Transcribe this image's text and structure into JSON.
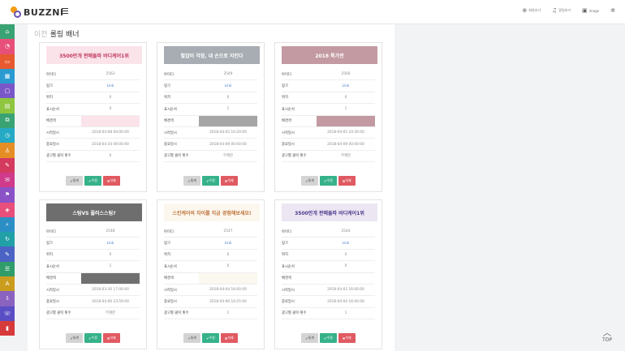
{
  "app": {
    "logo_text": "BUZZNI"
  },
  "header": {
    "items": [
      {
        "icon": "user-plus-icon",
        "label": "회원추가"
      },
      {
        "icon": "bell-icon",
        "label": "알림보기"
      },
      {
        "icon": "image-icon",
        "label": "image"
      },
      {
        "icon": "gear-icon",
        "label": ""
      }
    ]
  },
  "sidebar": {
    "colors": [
      "#3aa374",
      "#e84f7a",
      "#e75a2f",
      "#2a9bd1",
      "#7a57c8",
      "#8ec63f",
      "#3aa374",
      "#25a9c4",
      "#e58e26",
      "#d43a5e",
      "#cf3a8a",
      "#8a52c6",
      "#e84f7a",
      "#2b8fc6",
      "#22a0a8",
      "#4a63c4",
      "#2f9c6a",
      "#cb9d1f",
      "#8a62c0",
      "#5a4ec4",
      "#d63a3a"
    ]
  },
  "page": {
    "prev": "이전",
    "title": "롤링 배너"
  },
  "labels": {
    "id": "아이디",
    "link": "링크",
    "position": "위치",
    "order": "표시순서",
    "bg": "배경색",
    "start": "시작일시",
    "end": "종료일시",
    "clicks": "광고별 클릭 횟수",
    "btn_stat": "통계",
    "btn_edit": "수정",
    "btn_del": "삭제"
  },
  "cards": [
    {
      "banner_text": "3500만개 판매돌파 바디케어1위",
      "banner_bg": "#fbe3ea",
      "banner_fg": "#c0395d",
      "id": "2563",
      "link": "Link",
      "position": "0",
      "order": "0",
      "bg_color": "#fbe3ea",
      "start": "2018-04-08 09:00:00",
      "end": "2018-04-10 09:00:00",
      "clicks": "0"
    },
    {
      "banner_text": "혈압이 걱정, 내 손으로 지킨다",
      "banner_bg": "#a8adb3",
      "banner_fg": "#ffffff",
      "id": "2549",
      "link": "Link",
      "position": "0",
      "order": "1",
      "bg_color": "#a5a5a5",
      "start": "2018-04-02 10:20:00",
      "end": "2018-04-09 00:00:00",
      "clicks": "무제한"
    },
    {
      "banner_text": "2018 특가전",
      "banner_bg": "#c39aa2",
      "banner_fg": "#ffffff",
      "id": "2560",
      "link": "Link",
      "position": "0",
      "order": "1",
      "bg_color": "#c39aa2",
      "start": "2018-04-05 10:30:00",
      "end": "2018-04-09 00:00:00",
      "clicks": "무제한"
    },
    {
      "banner_text": "스팀VS 플러스스팀?",
      "banner_bg": "#6e6e6e",
      "banner_fg": "#ffffff",
      "id": "2548",
      "link": "Link",
      "position": "0",
      "order": "1",
      "bg_color": "#707070",
      "start": "2018-03-30 17:00:00",
      "end": "2018-04-06 23:59:00",
      "clicks": "무제한"
    },
    {
      "banner_text": "스킨케어의 차이를 지금 경험해보세요!",
      "banner_bg": "#fbf7ee",
      "banner_fg": "#c0743a",
      "id": "2547",
      "link": "Link",
      "position": "0",
      "order": "0",
      "bg_color": "#fbf8ef",
      "start": "2018-04-04 16:00:00",
      "end": "2018-04-06 10:25:00",
      "clicks": "1"
    },
    {
      "banner_text": "3500만개 판매돌파 바디케어1위",
      "banner_bg": "#ece6f3",
      "banner_fg": "#4b3a8a",
      "id": "2544",
      "link": "Link",
      "position": "0",
      "order": "0",
      "bg_color": "#ffffff",
      "start": "2018-04-02 16:00:00",
      "end": "2018-04-04 16:00:00",
      "clicks": "1"
    }
  ],
  "top_button": {
    "label": "TOP"
  }
}
